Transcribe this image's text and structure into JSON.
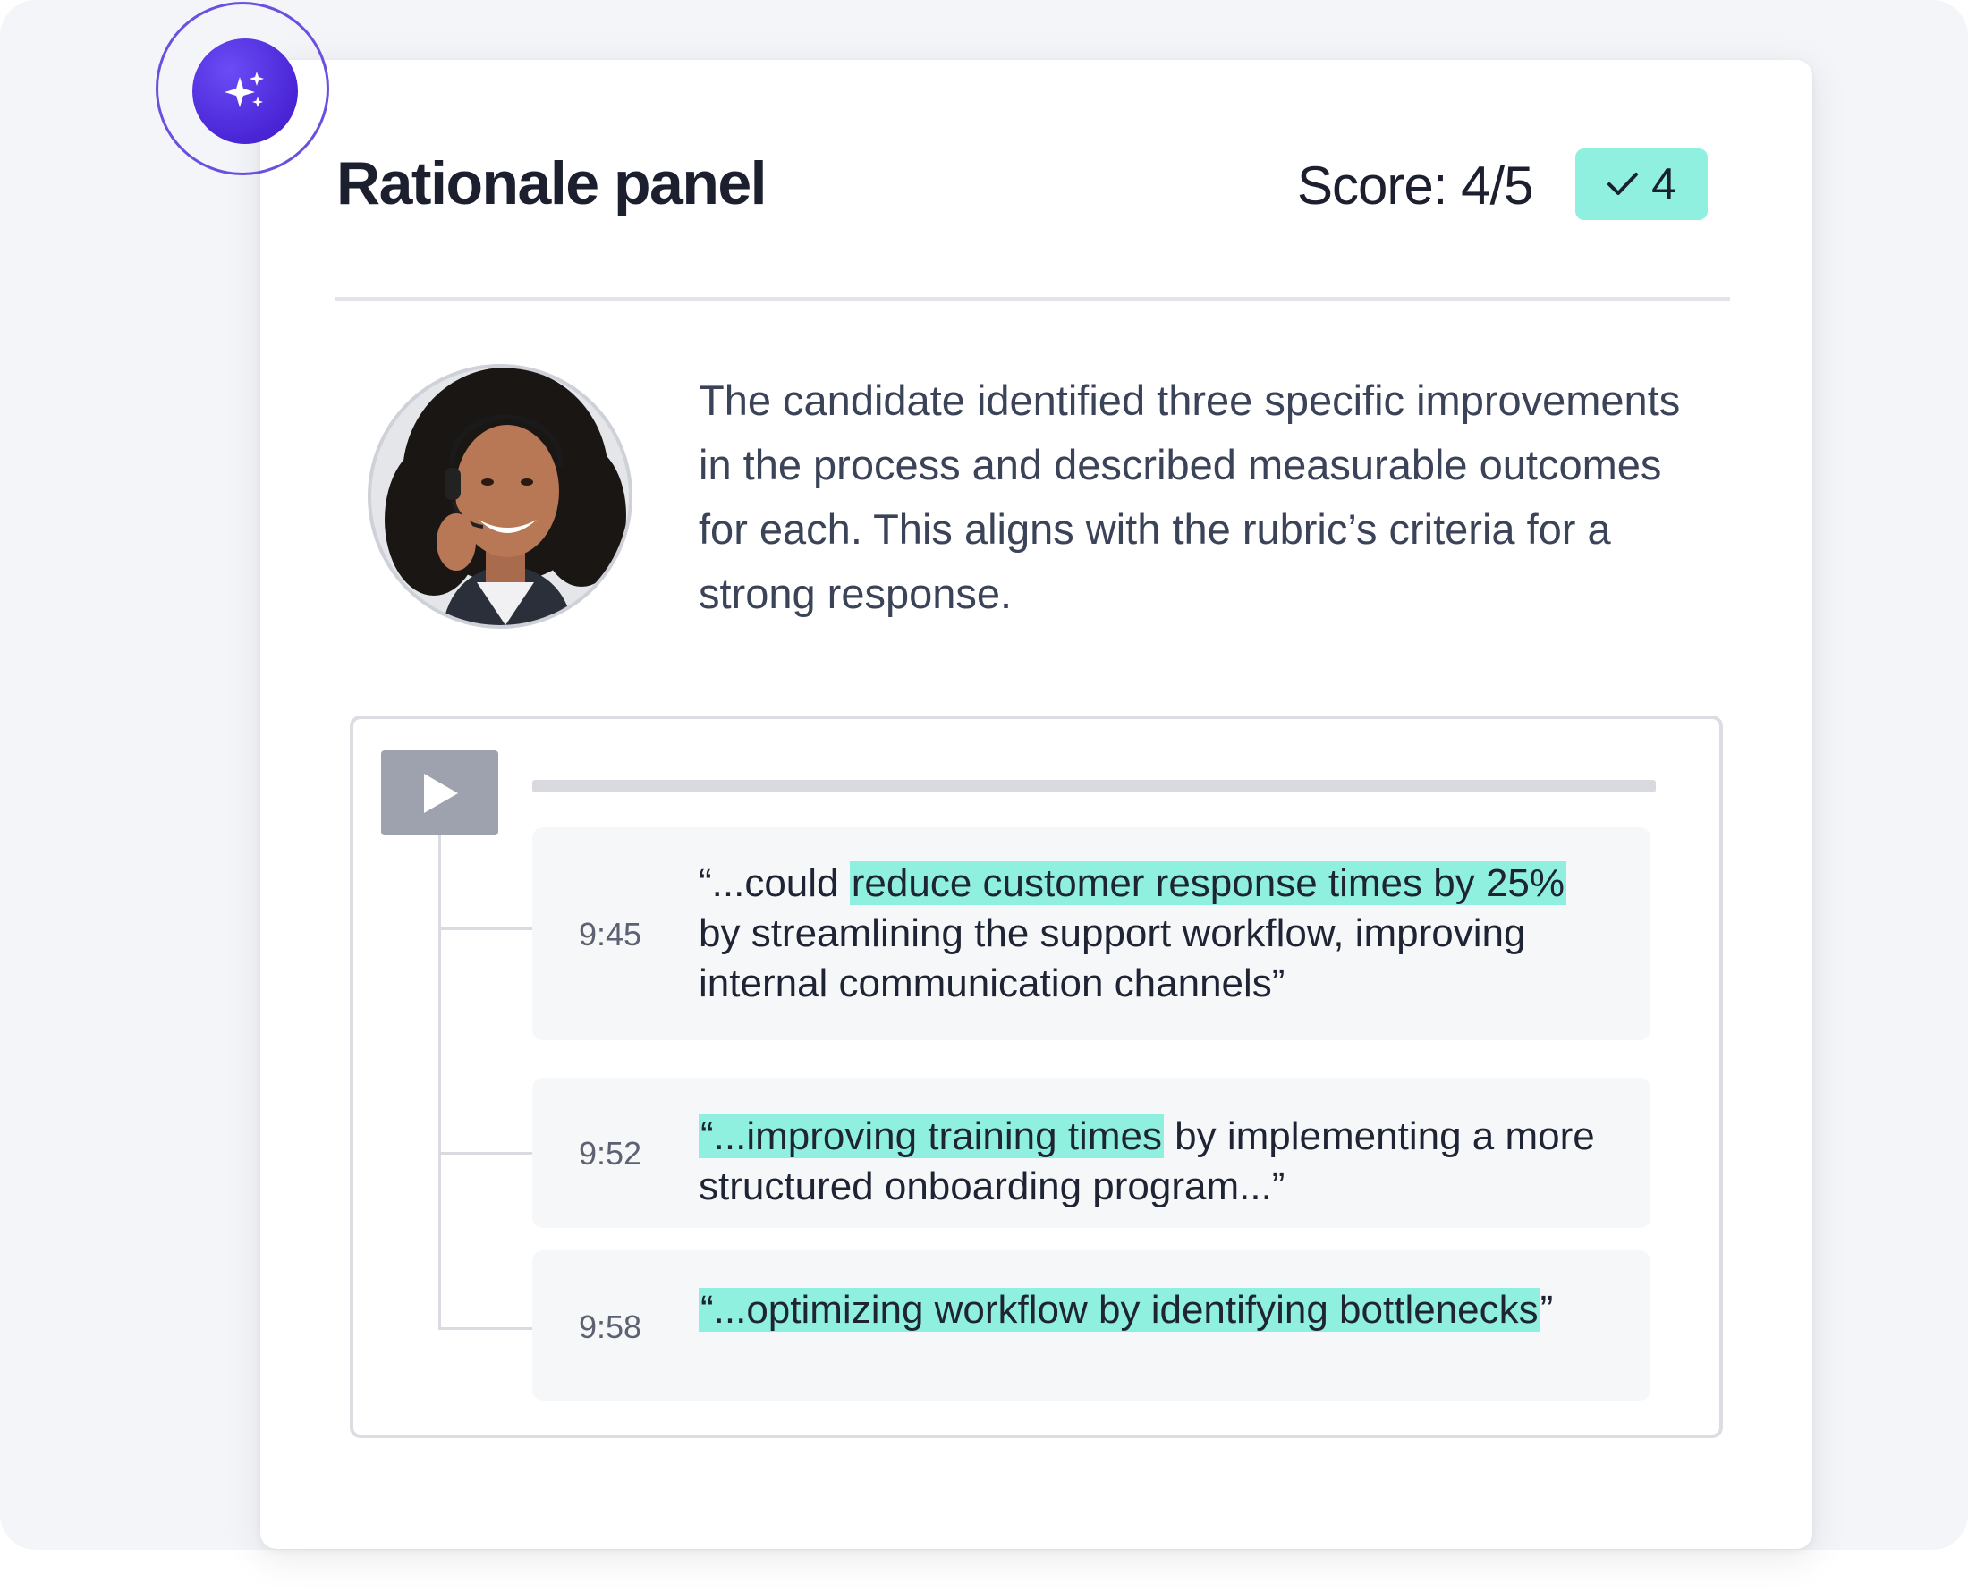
{
  "panel": {
    "title": "Rationale panel",
    "score_label": "Score: 4/5",
    "score_badge_value": "4",
    "rationale_text": "The candidate identified three specific improvements in the process and described measurable outcomes for each. This aligns with the rubric’s criteria for a strong response."
  },
  "icons": {
    "ai_badge": "sparkles-icon",
    "score_check": "check-icon",
    "play": "play-icon"
  },
  "colors": {
    "accent_purple": "#4a25d6",
    "highlight_teal": "#8ff0df",
    "title_text": "#1b1f2e"
  },
  "quotes": [
    {
      "time": "9:45",
      "pre": "“...could ",
      "highlight": "reduce customer response times by 25%",
      "post": " by streamlining the support workflow, improving internal communication channels”"
    },
    {
      "time": "9:52",
      "pre": "",
      "highlight": "“...improving training times",
      "post": " by implementing a more structured onboarding program...”"
    },
    {
      "time": "9:58",
      "pre": "",
      "highlight": "“...optimizing workflow by identifying bottlenecks",
      "post": "”"
    }
  ]
}
